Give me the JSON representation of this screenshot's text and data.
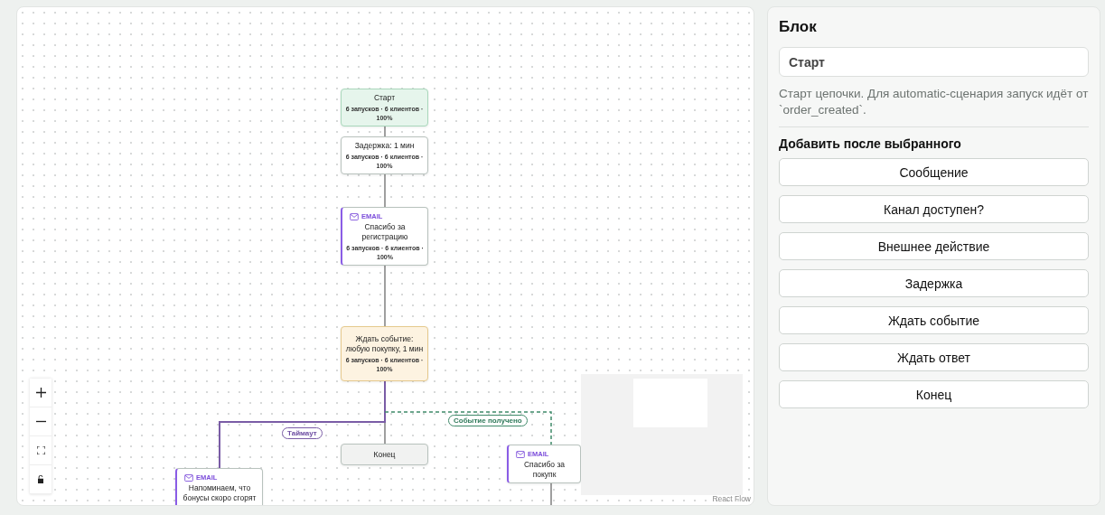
{
  "canvas": {
    "nodes": [
      {
        "kind": "start",
        "title": "Старт",
        "stats": "6 запусков · 6 клиентов · 100%"
      },
      {
        "kind": "delay",
        "title": "Задержка: 1 мин",
        "stats": "6 запусков · 6 клиентов · 100%"
      },
      {
        "kind": "email",
        "channel": "EMAIL",
        "title": "Спасибо за регистрацию",
        "stats": "6 запусков · 6 клиентов · 100%"
      },
      {
        "kind": "wait",
        "title": "Ждать событие: любую покупку, 1 мин",
        "stats": "6 запусков · 6 клиентов · 100%"
      },
      {
        "kind": "end",
        "title": "Конец"
      },
      {
        "kind": "email",
        "channel": "EMAIL",
        "title": "Напоминаем, что бонусы скоро сгорят"
      },
      {
        "kind": "email",
        "channel": "EMAIL",
        "title": "Спасибо за покупк"
      }
    ],
    "edges": [
      {
        "kind": "plain"
      },
      {
        "kind": "plain"
      },
      {
        "kind": "plain"
      },
      {
        "kind": "plain"
      },
      {
        "kind": "timeout",
        "label": "Таймаут"
      },
      {
        "kind": "event",
        "label": "Событие получено"
      },
      {
        "kind": "plain"
      }
    ],
    "attribution": "React Flow"
  },
  "panel": {
    "title": "Блок",
    "name_value": "Старт",
    "description": "Старт цепочки. Для automatic-сценария запуск идёт от `order_created`.",
    "add_title": "Добавить после выбранного",
    "buttons": [
      "Сообщение",
      "Канал доступен?",
      "Внешнее действие",
      "Задержка",
      "Ждать событие",
      "Ждать ответ",
      "Конец"
    ]
  }
}
